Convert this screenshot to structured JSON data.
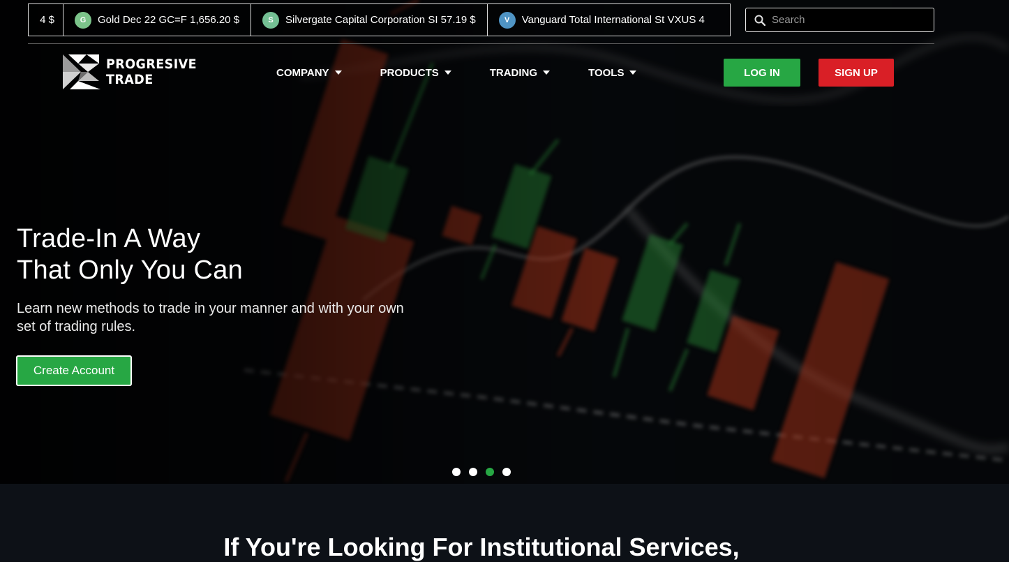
{
  "ticker": {
    "items": [
      {
        "icon": "",
        "text": "4 $",
        "partial": true
      },
      {
        "icon": "G",
        "icon_color": "#7cc48a",
        "text": "Gold Dec 22 GC=F 1,656.20 $"
      },
      {
        "icon": "S",
        "icon_color": "#74c094",
        "text": "Silvergate Capital Corporation SI 57.19 $"
      },
      {
        "icon": "V",
        "icon_color": "#4f94c4",
        "text": "Vanguard Total International St VXUS 4"
      }
    ]
  },
  "search": {
    "placeholder": "Search",
    "icon": "search-icon"
  },
  "logo": {
    "line1": "PROGRESIVE",
    "line2": "TRADE"
  },
  "nav": {
    "items": [
      {
        "label": "COMPANY"
      },
      {
        "label": "PRODUCTS"
      },
      {
        "label": "TRADING"
      },
      {
        "label": "TOOLS"
      }
    ]
  },
  "auth": {
    "login_label": "LOG IN",
    "signup_label": "SIGN UP"
  },
  "hero": {
    "title_line1": "Trade-In A Way",
    "title_line2": "That Only You Can",
    "subtitle_line1": "Learn new methods to trade in your manner and with your own",
    "subtitle_line2": "set of trading rules.",
    "cta_label": "Create Account",
    "slides": 4,
    "active_slide": 3
  },
  "section": {
    "title": "If You're Looking For Institutional Services,"
  },
  "colors": {
    "green": "#27a744",
    "red": "#d91f26",
    "candle_up": "#2f9a3c",
    "candle_down": "#c23a1e"
  }
}
